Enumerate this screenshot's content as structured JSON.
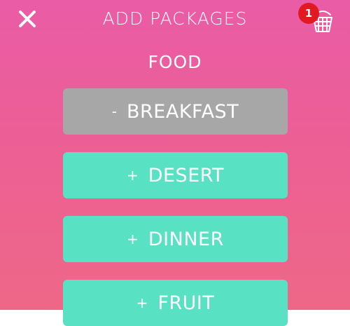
{
  "header": {
    "title": "ADD PACKAGES",
    "cart_count": "1"
  },
  "section": {
    "title": "FOOD"
  },
  "packages": [
    {
      "sign": "-",
      "label": "BREAKFAST"
    },
    {
      "sign": "+",
      "label": "DESERT"
    },
    {
      "sign": "+",
      "label": "DINNER"
    },
    {
      "sign": "+",
      "label": "FRUIT"
    }
  ],
  "colors": {
    "bg_top": "#ea5ca6",
    "bg_bottom": "#ee6787",
    "selected": "#a7a7a7",
    "option": "#58e1c2",
    "badge": "#e11a22"
  }
}
